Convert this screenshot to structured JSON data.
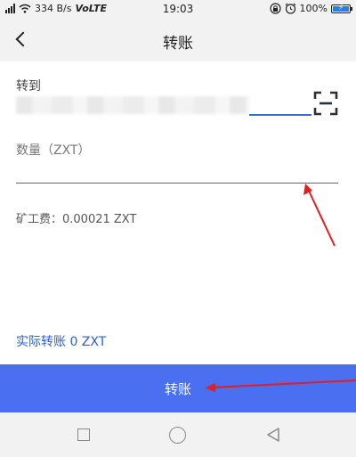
{
  "status_bar": {
    "signal_label": "all",
    "speed": "334 B/s",
    "network": "VoLTE",
    "time": "19:03",
    "battery_percent": "100%",
    "battery_level": 1.0,
    "icons": [
      "signal-icon",
      "wifi-icon",
      "lock-rotation-icon",
      "alarm-icon",
      "battery-charging-icon"
    ]
  },
  "app_bar": {
    "title": "转账",
    "back_icon": "back-chevron-icon"
  },
  "form": {
    "to_label": "转到",
    "address_value": "",
    "scan_icon": "scan-icon",
    "amount_placeholder": "数量（ZXT）",
    "fee_text": "矿工费：0.00021  ZXT"
  },
  "summary": {
    "actual_transfer": "实际转账 0 ZXT"
  },
  "transfer_button": {
    "label": "转账"
  },
  "nav_bar": {
    "icons": [
      "recent-apps-icon",
      "home-icon",
      "back-triangle-icon"
    ]
  },
  "colors": {
    "accent": "#4a6ff0",
    "link": "#2a5fd6",
    "annotation": "#e02020",
    "bar_background": "#f2f2f2"
  }
}
